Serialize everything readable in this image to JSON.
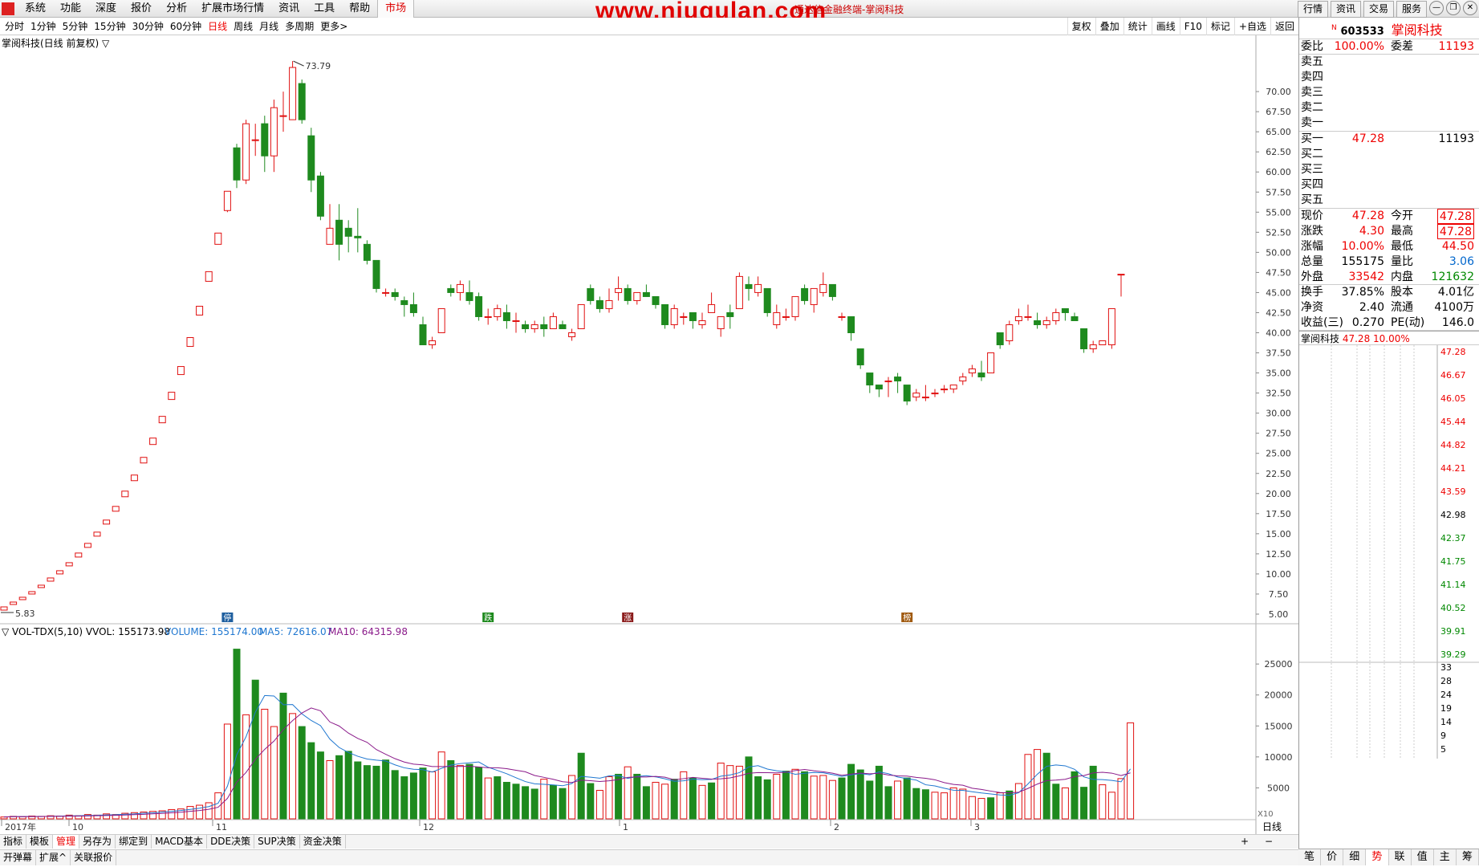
{
  "menubar": {
    "items": [
      "系统",
      "功能",
      "深度",
      "报价",
      "分析",
      "扩展市场行情",
      "资讯",
      "工具",
      "帮助"
    ],
    "market": "市场",
    "watermark": "www.niugulan.com",
    "window_title": "通达信金融终端-掌阅科技",
    "right_buttons": [
      "行情",
      "资讯",
      "交易",
      "服务"
    ]
  },
  "period_bar": {
    "periods": [
      "分时",
      "1分钟",
      "5分钟",
      "15分钟",
      "30分钟",
      "60分钟",
      "日线",
      "周线",
      "月线",
      "多周期",
      "更多>"
    ],
    "active": "日线",
    "right_tools": [
      "复权",
      "叠加",
      "统计",
      "画线",
      "F10",
      "标记",
      "+自选",
      "返回"
    ]
  },
  "kline_panel": {
    "title": "掌阅科技(日线 前复权) ▽",
    "max_label": "73.79",
    "min_label": "5.83",
    "y_ticks": [
      "70.00",
      "67.50",
      "65.00",
      "62.50",
      "60.00",
      "57.50",
      "55.00",
      "52.50",
      "50.00",
      "47.50",
      "45.00",
      "42.50",
      "40.00",
      "37.50",
      "35.00",
      "32.50",
      "30.00",
      "27.50",
      "25.00",
      "22.50",
      "20.00",
      "17.50",
      "15.00",
      "12.50",
      "10.00",
      "7.50",
      "5.00"
    ],
    "markers": [
      "停",
      "跌",
      "涨",
      "榜"
    ]
  },
  "volume_panel": {
    "title": "▽ VOL-TDX(5,10)  VVOL: 155173.98",
    "volume": "VOLUME: 155174.00",
    "ma5": "MA5: 72616.07",
    "ma10": "MA10: 64315.98",
    "y_ticks": [
      "25000",
      "20000",
      "15000",
      "10000",
      "5000"
    ],
    "unit": "X10"
  },
  "x_axis": [
    "2017年",
    "10",
    "11",
    "12",
    "1",
    "2",
    "3"
  ],
  "indicator_tabs": [
    "指标",
    "模板",
    "管理",
    "另存为",
    "绑定到",
    "MACD基本",
    "DDE决策",
    "SUP决策",
    "资金决策"
  ],
  "indicator_tabs_active": "管理",
  "bottom_tabs": [
    "开弹幕",
    "扩展^",
    "关联报价"
  ],
  "period_label": "日线",
  "zoom": [
    "+",
    "−"
  ],
  "quote_panel": {
    "code": "603533",
    "badge": "N",
    "name": "掌阅科技",
    "weibi_label": "委比",
    "weibi": "100.00%",
    "weicha_label": "委差",
    "weicha": "11193",
    "sell": [
      "卖五",
      "卖四",
      "卖三",
      "卖二",
      "卖一"
    ],
    "buy": [
      {
        "label": "买一",
        "price": "47.28",
        "vol": "11193"
      },
      {
        "label": "买二",
        "price": "",
        "vol": ""
      },
      {
        "label": "买三",
        "price": "",
        "vol": ""
      },
      {
        "label": "买四",
        "price": "",
        "vol": ""
      },
      {
        "label": "买五",
        "price": "",
        "vol": ""
      }
    ],
    "stats": [
      {
        "l1": "现价",
        "v1": "47.28",
        "l2": "今开",
        "v2": "47.28"
      },
      {
        "l1": "涨跌",
        "v1": "4.30",
        "l2": "最高",
        "v2": "47.28"
      },
      {
        "l1": "涨幅",
        "v1": "10.00%",
        "l2": "最低",
        "v2": "44.50"
      },
      {
        "l1": "总量",
        "v1": "155175",
        "l2": "量比",
        "v2": "3.06"
      },
      {
        "l1": "外盘",
        "v1": "33542",
        "l2": "内盘",
        "v2": "121632"
      },
      {
        "l1": "换手",
        "v1": "37.85%",
        "l2": "股本",
        "v2": "4.01亿"
      },
      {
        "l1": "净资",
        "v1": "2.40",
        "l2": "流通",
        "v2": "4100万"
      },
      {
        "l1": "收益(三)",
        "v1": "0.270",
        "l2": "PE(动)",
        "v2": "146.0"
      }
    ],
    "mini_title": "掌阅科技",
    "mini_price": "47.28",
    "mini_pct": "10.00%",
    "mini_ticks": [
      "47.28",
      "46.67",
      "46.05",
      "45.44",
      "44.82",
      "44.21",
      "43.59",
      "42.98",
      "42.37",
      "41.75",
      "41.14",
      "40.52",
      "39.91",
      "39.29",
      "33",
      "28",
      "24",
      "19",
      "14",
      "9",
      "5"
    ],
    "tabs": [
      "笔",
      "价",
      "细",
      "势",
      "联",
      "值",
      "主",
      "筹"
    ],
    "tabs_active": "势"
  },
  "colors": {
    "up": "#e01010",
    "down": "#1e8a1e",
    "ma5": "#1f77d0",
    "ma10": "#8a1a8a",
    "accent": "#e00000"
  },
  "chart_data": {
    "type": "candlestick",
    "ylim": [
      5,
      75
    ],
    "x_labels": [
      "2017年",
      "10",
      "11",
      "12",
      "1",
      "2",
      "3"
    ],
    "ohlc": [
      [
        5.5,
        5.9,
        5.5,
        5.9
      ],
      [
        6.2,
        6.5,
        6.2,
        6.5
      ],
      [
        6.8,
        7.1,
        6.8,
        7.1
      ],
      [
        7.5,
        7.8,
        7.5,
        7.8
      ],
      [
        8.3,
        8.6,
        8.3,
        8.6
      ],
      [
        9.1,
        9.5,
        9.1,
        9.5
      ],
      [
        10.0,
        10.4,
        10.0,
        10.4
      ],
      [
        11.0,
        11.4,
        11.0,
        11.4
      ],
      [
        12.1,
        12.6,
        12.1,
        12.6
      ],
      [
        13.3,
        13.8,
        13.3,
        13.8
      ],
      [
        14.7,
        15.2,
        14.7,
        15.2
      ],
      [
        16.2,
        16.7,
        16.2,
        16.7
      ],
      [
        17.8,
        18.4,
        17.8,
        18.4
      ],
      [
        19.6,
        20.3,
        19.6,
        20.3
      ],
      [
        21.6,
        22.3,
        21.6,
        22.3
      ],
      [
        23.8,
        24.5,
        23.8,
        24.5
      ],
      [
        26.1,
        26.9,
        26.1,
        26.9
      ],
      [
        28.8,
        29.6,
        28.8,
        29.6
      ],
      [
        31.7,
        32.6,
        31.7,
        32.6
      ],
      [
        34.8,
        35.8,
        34.8,
        35.8
      ],
      [
        38.3,
        39.4,
        38.3,
        39.4
      ],
      [
        42.2,
        43.3,
        42.2,
        43.3
      ],
      [
        46.4,
        47.6,
        46.4,
        47.6
      ],
      [
        51.0,
        52.4,
        51.0,
        52.4
      ],
      [
        55.2,
        57.6,
        55.0,
        57.0
      ],
      [
        63.0,
        59.0,
        58.0,
        63.5
      ],
      [
        59.0,
        66.0,
        58.5,
        66.5
      ],
      [
        64.0,
        64.0,
        62.0,
        66.0
      ],
      [
        66.0,
        62.0,
        60.0,
        67.0
      ],
      [
        62.0,
        68.0,
        60.0,
        69.0
      ],
      [
        67.0,
        67.0,
        65.0,
        70.0
      ],
      [
        66.5,
        73.0,
        66.5,
        73.79
      ],
      [
        71.0,
        66.5,
        66.0,
        71.5
      ],
      [
        64.5,
        59.0,
        57.5,
        65.5
      ],
      [
        59.5,
        54.5,
        54.0,
        60.0
      ],
      [
        51.0,
        53.0,
        51.0,
        56.0
      ],
      [
        54.0,
        51.0,
        49.0,
        56.0
      ],
      [
        53.0,
        52.0,
        50.0,
        54.0
      ],
      [
        52.0,
        51.8,
        50.0,
        55.5
      ],
      [
        51.0,
        49.0,
        48.5,
        51.5
      ],
      [
        49.0,
        45.5,
        45.0,
        49.0
      ],
      [
        45.0,
        45.0,
        44.5,
        45.5
      ],
      [
        45.0,
        44.5,
        44.0,
        45.5
      ],
      [
        44.0,
        43.5,
        42.0,
        44.5
      ],
      [
        43.5,
        42.5,
        42.0,
        45.0
      ],
      [
        41.0,
        38.5,
        38.5,
        42.0
      ],
      [
        38.5,
        39.0,
        38.0,
        39.5
      ],
      [
        40.0,
        43.0,
        40.0,
        43.0
      ],
      [
        45.5,
        45.0,
        44.5,
        46.0
      ],
      [
        45.0,
        46.0,
        44.0,
        46.5
      ],
      [
        45.0,
        44.0,
        43.5,
        46.5
      ],
      [
        44.5,
        42.0,
        41.5,
        45.0
      ],
      [
        42.0,
        42.0,
        41.0,
        43.0
      ],
      [
        42.0,
        43.0,
        41.5,
        43.5
      ],
      [
        42.5,
        41.5,
        40.5,
        43.5
      ],
      [
        41.5,
        41.5,
        40.0,
        42.5
      ],
      [
        41.0,
        40.5,
        40.0,
        41.5
      ],
      [
        40.5,
        41.0,
        40.0,
        41.5
      ],
      [
        41.0,
        40.5,
        39.5,
        42.0
      ],
      [
        40.5,
        42.0,
        40.5,
        42.5
      ],
      [
        41.0,
        40.5,
        40.5,
        41.5
      ],
      [
        39.5,
        40.0,
        39.0,
        40.5
      ],
      [
        40.5,
        43.5,
        40.5,
        43.5
      ],
      [
        45.5,
        44.0,
        43.5,
        46.0
      ],
      [
        44.0,
        43.0,
        42.5,
        44.5
      ],
      [
        43.0,
        44.0,
        42.5,
        45.5
      ],
      [
        45.0,
        45.5,
        44.0,
        47.0
      ],
      [
        45.5,
        44.0,
        43.5,
        46.0
      ],
      [
        44.0,
        45.0,
        43.5,
        45.0
      ],
      [
        45.0,
        44.5,
        44.5,
        46.0
      ],
      [
        44.5,
        43.5,
        43.0,
        44.5
      ],
      [
        43.5,
        41.0,
        40.5,
        43.5
      ],
      [
        41.0,
        43.0,
        40.5,
        43.5
      ],
      [
        42.0,
        42.0,
        41.0,
        42.5
      ],
      [
        42.5,
        41.5,
        40.5,
        42.5
      ],
      [
        41.0,
        41.5,
        40.5,
        42.5
      ],
      [
        42.5,
        43.5,
        42.5,
        45.0
      ],
      [
        40.5,
        42.0,
        39.5,
        42.0
      ],
      [
        42.5,
        42.0,
        40.5,
        43.5
      ],
      [
        43.0,
        47.0,
        43.0,
        47.5
      ],
      [
        46.0,
        45.5,
        44.0,
        47.0
      ],
      [
        45.0,
        46.0,
        44.5,
        47.0
      ],
      [
        45.5,
        42.5,
        42.0,
        45.5
      ],
      [
        41.0,
        42.5,
        40.5,
        43.5
      ],
      [
        42.0,
        42.0,
        41.5,
        43.0
      ],
      [
        42.0,
        44.5,
        41.5,
        44.5
      ],
      [
        45.5,
        44.0,
        43.5,
        46.0
      ],
      [
        43.5,
        45.5,
        42.5,
        45.5
      ],
      [
        45.0,
        46.0,
        44.5,
        47.5
      ],
      [
        46.0,
        44.5,
        44.0,
        46.0
      ],
      [
        42.0,
        42.0,
        41.5,
        42.5
      ],
      [
        42.0,
        40.0,
        39.0,
        42.0
      ],
      [
        38.0,
        36.0,
        35.5,
        38.0
      ],
      [
        35.0,
        33.5,
        32.5,
        35.0
      ],
      [
        33.5,
        33.0,
        32.0,
        33.5
      ],
      [
        34.0,
        34.0,
        32.0,
        34.5
      ],
      [
        34.5,
        34.0,
        32.5,
        35.0
      ],
      [
        33.5,
        31.5,
        31.0,
        33.5
      ],
      [
        32.0,
        32.5,
        31.5,
        33.0
      ],
      [
        32.0,
        32.0,
        31.5,
        33.5
      ],
      [
        32.5,
        32.5,
        32.0,
        33.0
      ],
      [
        33.0,
        33.0,
        32.5,
        33.5
      ],
      [
        33.0,
        33.5,
        32.5,
        33.5
      ],
      [
        34.0,
        34.5,
        33.5,
        35.0
      ],
      [
        35.0,
        35.5,
        34.5,
        36.0
      ],
      [
        35.0,
        34.5,
        34.0,
        36.5
      ],
      [
        35.0,
        37.5,
        35.0,
        37.5
      ],
      [
        40.0,
        38.5,
        38.0,
        40.0
      ],
      [
        39.0,
        41.0,
        38.5,
        41.5
      ],
      [
        41.5,
        42.0,
        41.0,
        43.0
      ],
      [
        42.0,
        42.0,
        41.5,
        43.5
      ],
      [
        41.5,
        41.0,
        40.5,
        42.5
      ],
      [
        41.0,
        41.5,
        40.5,
        42.0
      ],
      [
        41.5,
        42.5,
        41.0,
        43.0
      ],
      [
        43.0,
        42.5,
        41.5,
        43.0
      ],
      [
        42.0,
        41.5,
        41.5,
        42.5
      ],
      [
        40.5,
        38.0,
        37.5,
        40.5
      ],
      [
        38.0,
        38.5,
        37.5,
        39.0
      ],
      [
        38.5,
        39.0,
        38.5,
        39.0
      ],
      [
        38.5,
        43.0,
        38.0,
        43.0
      ],
      [
        47.28,
        47.28,
        44.5,
        47.28
      ]
    ],
    "volume": [
      30,
      40,
      35,
      45,
      40,
      50,
      45,
      60,
      50,
      70,
      60,
      80,
      70,
      90,
      100,
      110,
      120,
      130,
      150,
      160,
      200,
      220,
      260,
      420,
      1530,
      2740,
      1680,
      2240,
      1770,
      1490,
      2030,
      1700,
      1490,
      1230,
      1080,
      940,
      1020,
      1090,
      920,
      860,
      850,
      950,
      780,
      680,
      740,
      820,
      760,
      1080,
      940,
      860,
      880,
      830,
      660,
      680,
      590,
      560,
      520,
      480,
      640,
      540,
      490,
      700,
      1060,
      570,
      460,
      680,
      720,
      840,
      720,
      520,
      590,
      560,
      640,
      760,
      660,
      540,
      580,
      900,
      860,
      850,
      1000,
      680,
      630,
      720,
      770,
      800,
      760,
      690,
      700,
      620,
      660,
      880,
      790,
      610,
      850,
      520,
      610,
      660,
      490,
      470,
      430,
      420,
      500,
      480,
      360,
      330,
      340,
      420,
      450,
      570,
      1040,
      1120,
      1060,
      560,
      500,
      760,
      510,
      850,
      550,
      430,
      650,
      1550
    ],
    "volume_up": [
      1,
      1,
      1,
      1,
      1,
      1,
      1,
      1,
      1,
      1,
      1,
      1,
      1,
      1,
      1,
      1,
      1,
      1,
      1,
      1,
      1,
      1,
      1,
      1,
      1,
      0,
      1,
      0,
      1,
      1,
      0,
      1,
      0,
      0,
      0,
      1,
      0,
      0,
      0,
      0,
      0,
      0,
      0,
      0,
      0,
      0,
      1,
      1,
      0,
      1,
      0,
      0,
      1,
      0,
      0,
      0,
      0,
      0,
      1,
      0,
      0,
      1,
      0,
      0,
      1,
      1,
      0,
      1,
      0,
      0,
      1,
      1,
      0,
      1,
      0,
      1,
      0,
      1,
      1,
      1,
      0,
      0,
      0,
      1,
      0,
      1,
      0,
      1,
      1,
      1,
      0,
      0,
      0,
      0,
      0,
      0,
      1,
      0,
      0,
      0,
      1,
      1,
      1,
      1,
      1,
      1,
      0,
      1,
      0,
      1,
      1,
      1,
      0,
      0,
      1,
      0,
      0,
      0,
      1,
      1,
      1,
      1
    ],
    "ma5": [],
    "ma10": []
  }
}
